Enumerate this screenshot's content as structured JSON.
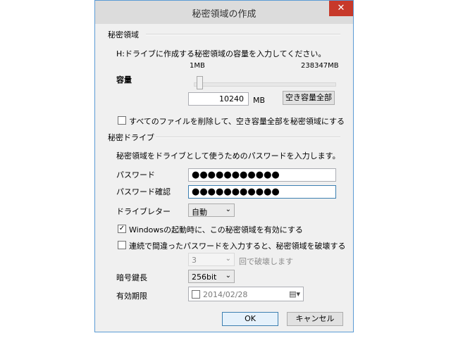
{
  "dialog": {
    "title": "秘密領域の作成",
    "close_glyph": "✕"
  },
  "area_group": {
    "label": "秘密領域",
    "instruction": "H:ドライブに作成する秘密領域の容量を入力してください。",
    "min_label": "1MB",
    "max_label": "238347MB",
    "capacity_label": "容量",
    "slider_value_fraction": 0.043,
    "capacity_value": "10240",
    "unit": "MB",
    "all_free_button": "空き容量全部",
    "delete_all_checkbox": {
      "label": "すべてのファイルを削除して、空き容量全部を秘密領域にする",
      "checked": false
    }
  },
  "drive_group": {
    "label": "秘密ドライブ",
    "instruction": "秘密領域をドライブとして使うためのパスワードを入力します。",
    "password_label": "パスワード",
    "password_value": "●●●●●●●●●●●",
    "confirm_label": "パスワード確認",
    "confirm_value": "●●●●●●●●●●●",
    "drive_letter_label": "ドライブレター",
    "drive_letter_value": "自動",
    "startup_checkbox": {
      "label": "Windowsの起動時に、この秘密領域を有効にする",
      "checked": true
    },
    "destroy_checkbox": {
      "label": "連続で間違ったパスワードを入力すると、秘密領域を破壊する",
      "checked": false
    },
    "destroy_count_value": "3",
    "destroy_suffix": "回で破壊します",
    "key_length_label": "暗号鍵長",
    "key_length_value": "256bit",
    "expiry_label": "有効期限",
    "expiry_date": "2014/02/28"
  },
  "buttons": {
    "ok": "OK",
    "cancel": "キャンセル"
  }
}
